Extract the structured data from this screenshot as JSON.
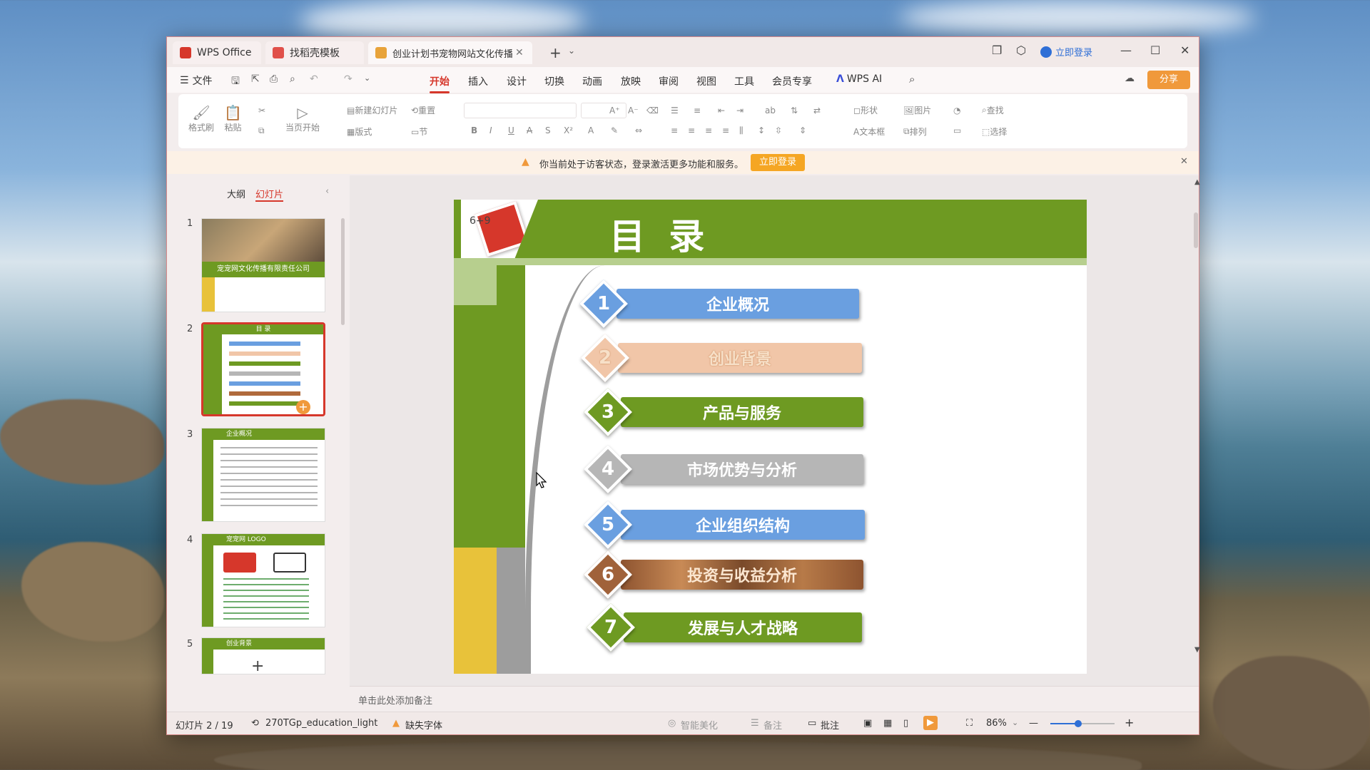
{
  "tabs": [
    {
      "label": "WPS Office",
      "color": "#d6372b"
    },
    {
      "label": "找稻壳模板",
      "color": "#e0504a"
    },
    {
      "label": "创业计划书宠物网站文化传播",
      "color": "#e8a33a"
    }
  ],
  "account": {
    "login_label": "立即登录"
  },
  "menu": {
    "file_label": "文件",
    "items": [
      "开始",
      "插入",
      "设计",
      "切换",
      "动画",
      "放映",
      "审阅",
      "视图",
      "工具",
      "会员专享"
    ],
    "ai_label": "WPS AI",
    "share_label": "分享"
  },
  "ribbon": {
    "format_painter": "格式刷",
    "paste": "粘贴",
    "from_current": "当页开始",
    "new_slide": "新建幻灯片",
    "reset": "重置",
    "layout": "版式",
    "section": "节",
    "shapes": "形状",
    "picture": "图片",
    "textbox": "文本框",
    "arrange": "排列",
    "find": "查找",
    "select": "选择"
  },
  "notice": {
    "text": "你当前处于访客状态，登录激活更多功能和服务。",
    "button": "立即登录"
  },
  "panel": {
    "outline_tab": "大纲",
    "slides_tab": "幻灯片"
  },
  "thumbnails": [
    {
      "num": "1",
      "caption": "宠宠网文化传播有限责任公司"
    },
    {
      "num": "2",
      "caption": "目 录"
    },
    {
      "num": "3",
      "caption": "企业概况"
    },
    {
      "num": "4",
      "caption": "宠宠网 LOGO"
    },
    {
      "num": "5",
      "caption": "创业背景"
    }
  ],
  "slide": {
    "title": "目 录",
    "badge": "6+9",
    "items": [
      {
        "num": "1",
        "label": "企业概况",
        "color": "#6a9fe0"
      },
      {
        "num": "2",
        "label": "创业背景",
        "color": "#f1c6a8"
      },
      {
        "num": "3",
        "label": "产品与服务",
        "color": "#6e9a22"
      },
      {
        "num": "4",
        "label": "市场优势与分析",
        "color": "#b6b6b6"
      },
      {
        "num": "5",
        "label": "企业组织结构",
        "color": "#6a9fe0"
      },
      {
        "num": "6",
        "label": "投资与收益分析",
        "color": "#b06a3c"
      },
      {
        "num": "7",
        "label": "发展与人才战略",
        "color": "#6e9a22"
      }
    ]
  },
  "notes_placeholder": "单击此处添加备注",
  "status": {
    "slide_counter": "幻灯片 2 / 19",
    "theme": "270TGp_education_light",
    "missing_font": "缺失字体",
    "smart_beautify": "智能美化",
    "notes": "备注",
    "comments": "批注",
    "zoom": "86%",
    "zoom_level": 0.86
  },
  "colors": {
    "accent": "#d6372b",
    "slide_green": "#6e9a22",
    "slide_light_green": "#b7cf8e",
    "slide_yellow": "#e8c23a",
    "slide_gray": "#9d9d9d"
  }
}
